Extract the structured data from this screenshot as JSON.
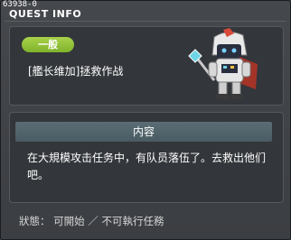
{
  "window": {
    "quest_id": "63938-0",
    "title": "QUEST INFO"
  },
  "quest": {
    "category_badge": "一般",
    "name": "[艦长维加]拯救作战"
  },
  "content": {
    "header": "内容",
    "description": "在大規模攻击任务中，有队员落伍了。去救出他们吧。"
  },
  "status": {
    "text": "狀態： 可開始 ／ 不可執行任務"
  },
  "colors": {
    "badge": "#8cc43a",
    "section_header": "#52656c",
    "panel": "#33363a"
  },
  "icons": {
    "npc": "robot-captain-npc-icon"
  }
}
